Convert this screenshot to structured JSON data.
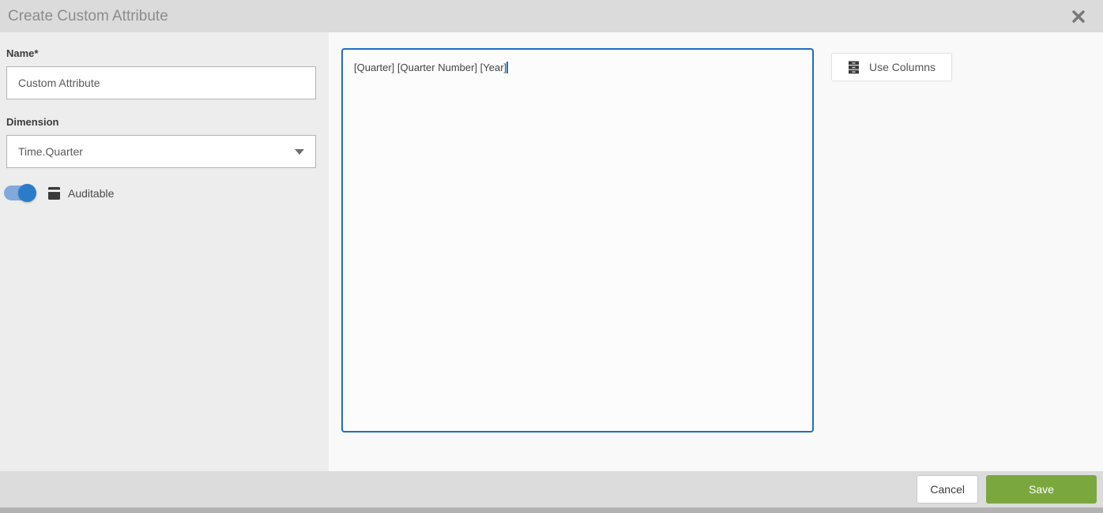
{
  "header": {
    "title": "Create Custom Attribute",
    "close_icon": "close-icon"
  },
  "form": {
    "name_label": "Name*",
    "name_value": "Custom Attribute",
    "dimension_label": "Dimension",
    "dimension_value": "Time.Quarter",
    "auditable_label": "Auditable",
    "auditable_on": true,
    "auditable_icon": "ledger-book-icon",
    "dimension_caret_icon": "chevron-down-icon"
  },
  "editor": {
    "formula_value": "[Quarter] [Quarter Number] [Year]"
  },
  "actions": {
    "use_columns_label": "Use Columns",
    "use_columns_icon": "stacked-columns-icon",
    "cancel_label": "Cancel",
    "save_label": "Save"
  },
  "colors": {
    "accent_blue": "#1f6fc2",
    "toggle_track_blue": "#82a9dc",
    "toggle_knob_blue": "#2a7cc9",
    "save_green": "#7aa83e",
    "header_gray": "#dbdbdb",
    "panel_gray": "#ededed",
    "footer_gray": "#dcdcdc"
  }
}
